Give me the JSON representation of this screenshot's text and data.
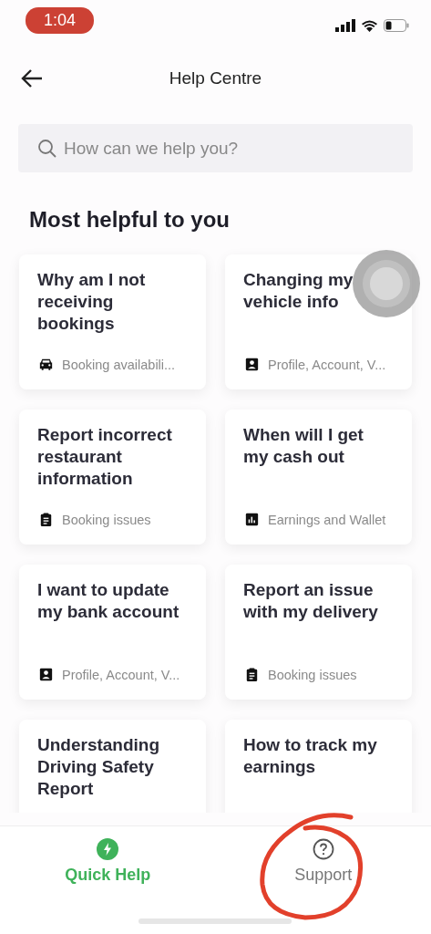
{
  "status_bar": {
    "time": "1:04"
  },
  "header": {
    "title": "Help Centre"
  },
  "search": {
    "placeholder": "How can we help you?"
  },
  "section": {
    "title": "Most helpful to you"
  },
  "cards": [
    {
      "title": "Why am I not receiving bookings",
      "kind": "car",
      "category": "Booking availabili..."
    },
    {
      "title": "Changing my vehicle info",
      "kind": "profile",
      "category": "Profile, Account, V..."
    },
    {
      "title": "Report incorrect restaurant information",
      "kind": "clipboard",
      "category": "Booking issues"
    },
    {
      "title": "When will I get my cash out",
      "kind": "chart",
      "category": "Earnings and Wallet"
    },
    {
      "title": "I want to update my bank account",
      "kind": "profile",
      "category": "Profile, Account, V..."
    },
    {
      "title": "Report an issue with my delivery",
      "kind": "clipboard",
      "category": "Booking issues"
    },
    {
      "title": "Understanding Driving Safety Report"
    },
    {
      "title": "How to track my earnings"
    }
  ],
  "tabs": [
    {
      "label": "Quick Help",
      "kind": "bolt",
      "selected": true
    },
    {
      "label": "Support",
      "kind": "question",
      "selected": false
    }
  ]
}
